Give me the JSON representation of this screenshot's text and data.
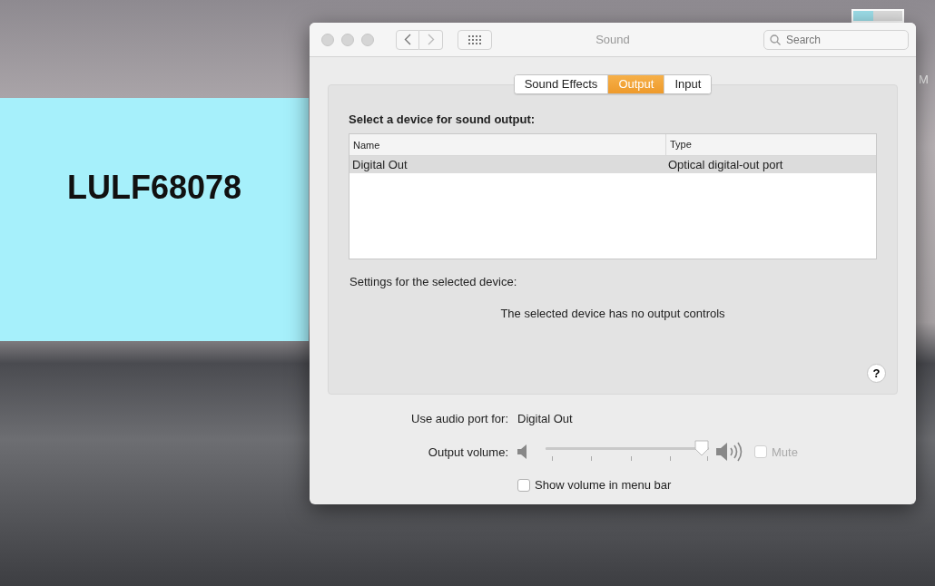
{
  "desktop": {
    "side_window": {
      "title": "LULF68078"
    },
    "clock_fragment": "M"
  },
  "window": {
    "title": "Sound",
    "search": {
      "placeholder": "Search"
    }
  },
  "tabs": [
    {
      "label": "Sound Effects",
      "selected": false
    },
    {
      "label": "Output",
      "selected": true
    },
    {
      "label": "Input",
      "selected": false
    }
  ],
  "device_section": {
    "heading": "Select a device for sound output:",
    "columns": [
      "Name",
      "Type"
    ],
    "rows": [
      {
        "cells": [
          "Digital Out",
          "Optical digital-out port"
        ],
        "selected": true
      }
    ],
    "settings_label": "Settings for the selected device:",
    "message": "The selected device has no output controls",
    "help": "?"
  },
  "audio_port": {
    "label": "Use audio port for:",
    "value": "Digital Out"
  },
  "output_volume": {
    "label": "Output volume:",
    "level": 1.0,
    "mute": {
      "label": "Mute",
      "checked": false,
      "disabled": true
    }
  },
  "show_in_menu_bar": {
    "label": "Show volume in menu bar",
    "checked": false
  }
}
